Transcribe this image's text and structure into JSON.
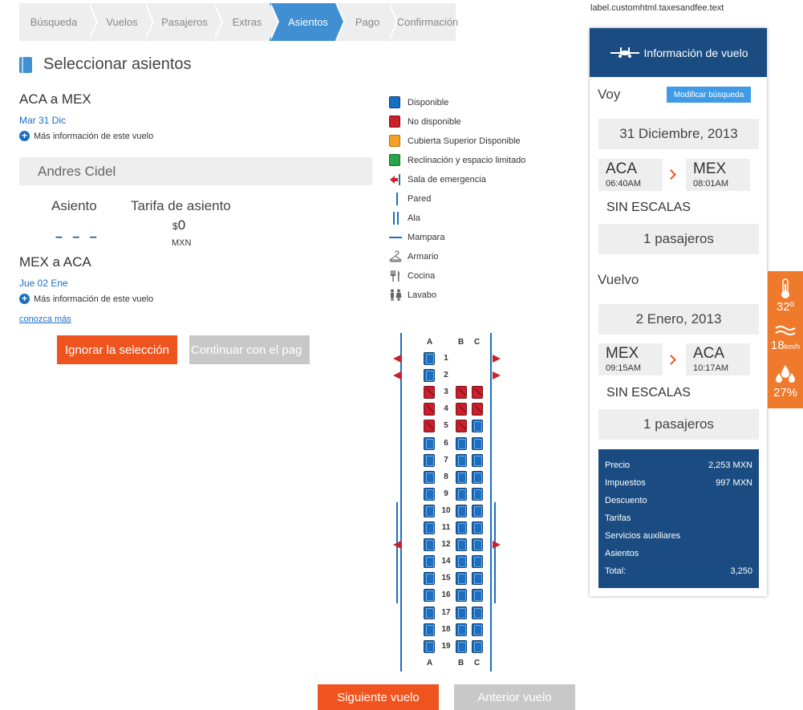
{
  "steps": [
    "Búsqueda",
    "Vuelos",
    "Pasajeros",
    "Extras",
    "Asientos",
    "Pago",
    "Confirmación"
  ],
  "active_step": "Asientos",
  "page_title": "Seleccionar asientos",
  "outbound": {
    "route": "ACA a MEX",
    "date": "Mar 31 Dic",
    "more_info": "Más información de este vuelo"
  },
  "passenger": {
    "name": "Andres Cidel",
    "seat_label": "Asiento",
    "fare_label": "Tarifa de asiento",
    "seat_value": "– – –",
    "price_symbol": "$",
    "price_value": "0",
    "currency": "MXN"
  },
  "return": {
    "route": "MEX a ACA",
    "date": "Jue 02 Ene",
    "more_info": "Más información de este vuelo"
  },
  "learn_more": "conozca más",
  "buttons": {
    "ignore": "Ignorar la selección",
    "continue": "Continuar con el pag",
    "next_flight": "Siguiente vuelo",
    "prev_flight": "Anterior vuelo"
  },
  "legend": [
    {
      "icon": "seat-available-icon",
      "label": "Disponible",
      "color": "#1a6fc4"
    },
    {
      "icon": "seat-unavailable-icon",
      "label": "No disponible",
      "color": "#c9202b"
    },
    {
      "icon": "seat-upper-deck-icon",
      "label": "Cubierta Superior Disponible",
      "color": "#f5a025"
    },
    {
      "icon": "seat-limited-recline-icon",
      "label": "Reclinación y espacio limitado",
      "color": "#2aa44a"
    },
    {
      "icon": "emergency-exit-icon",
      "label": "Sala de emergencia"
    },
    {
      "icon": "wall-icon",
      "label": "Pared"
    },
    {
      "icon": "wing-icon",
      "label": "Ala"
    },
    {
      "icon": "bulkhead-icon",
      "label": "Mampara"
    },
    {
      "icon": "closet-icon",
      "label": "Armario"
    },
    {
      "icon": "galley-icon",
      "label": "Cocina"
    },
    {
      "icon": "lavatory-icon",
      "label": "Lavabo"
    }
  ],
  "seatmap": {
    "columns": [
      "A",
      "B",
      "C"
    ],
    "rows": [
      {
        "n": "1",
        "A": "available",
        "B": null,
        "C": null,
        "exit": true
      },
      {
        "n": "2",
        "A": "available",
        "B": null,
        "C": null,
        "exit": true
      },
      {
        "n": "3",
        "A": "unavailable",
        "B": "unavailable",
        "C": "unavailable"
      },
      {
        "n": "4",
        "A": "unavailable",
        "B": "unavailable",
        "C": "unavailable"
      },
      {
        "n": "5",
        "A": "unavailable",
        "B": "unavailable",
        "C": "available"
      },
      {
        "n": "6",
        "A": "available",
        "B": "available",
        "C": "available"
      },
      {
        "n": "7",
        "A": "available",
        "B": "available",
        "C": "available"
      },
      {
        "n": "8",
        "A": "available",
        "B": "available",
        "C": "available"
      },
      {
        "n": "9",
        "A": "available",
        "B": "available",
        "C": "available"
      },
      {
        "n": "10",
        "A": "available",
        "B": "available",
        "C": "available",
        "wing": true
      },
      {
        "n": "11",
        "A": "available",
        "B": "available",
        "C": "available",
        "wing": true
      },
      {
        "n": "12",
        "A": "available",
        "B": "available",
        "C": "available",
        "exit": true,
        "wing": true
      },
      {
        "n": "14",
        "A": "available",
        "B": "available",
        "C": "available",
        "wing": true
      },
      {
        "n": "15",
        "A": "available",
        "B": "available",
        "C": "available",
        "wing": true
      },
      {
        "n": "16",
        "A": "available",
        "B": "available",
        "C": "available",
        "wing": true
      },
      {
        "n": "17",
        "A": "available",
        "B": "available",
        "C": "available"
      },
      {
        "n": "18",
        "A": "available",
        "B": "available",
        "C": "available"
      },
      {
        "n": "19",
        "A": "available",
        "B": "available",
        "C": "available"
      }
    ]
  },
  "tax_label": "label.customhtml.taxesandfee.text",
  "panel": {
    "title": "Información de vuelo",
    "outbound_label": "Voy",
    "modify_button": "Modificar búsqueda",
    "outbound_date": "31 Diciembre, 2013",
    "outbound_from": {
      "code": "ACA",
      "time": "06:40AM"
    },
    "outbound_to": {
      "code": "MEX",
      "time": "08:01AM"
    },
    "outbound_stops": "SIN ESCALAS",
    "outbound_pax": "1 pasajeros",
    "return_label": "Vuelvo",
    "return_date": "2 Enero, 2013",
    "return_from": {
      "code": "MEX",
      "time": "09:15AM"
    },
    "return_to": {
      "code": "ACA",
      "time": "10:17AM"
    },
    "return_stops": "SIN ESCALAS",
    "return_pax": "1 pasajeros",
    "fares": [
      {
        "label": "Precio",
        "value": "2,253 MXN"
      },
      {
        "label": "Impuestos",
        "value": "997 MXN"
      },
      {
        "label": "Descuento",
        "value": ""
      },
      {
        "label": "Tarifas",
        "value": ""
      },
      {
        "label": "Servicios auxiliares",
        "value": ""
      },
      {
        "label": "Asientos",
        "value": ""
      },
      {
        "label": "Total:",
        "value": "3,250"
      }
    ]
  },
  "weather": {
    "temperature": "32º",
    "wind": "18",
    "wind_unit": "km/h",
    "humidity": "27%"
  },
  "colors": {
    "accent": "#3f8fd2",
    "orange": "#f0541e",
    "navy": "#1a4c82",
    "seat_available": "#1a6fc4",
    "seat_unavailable": "#c9202b"
  }
}
